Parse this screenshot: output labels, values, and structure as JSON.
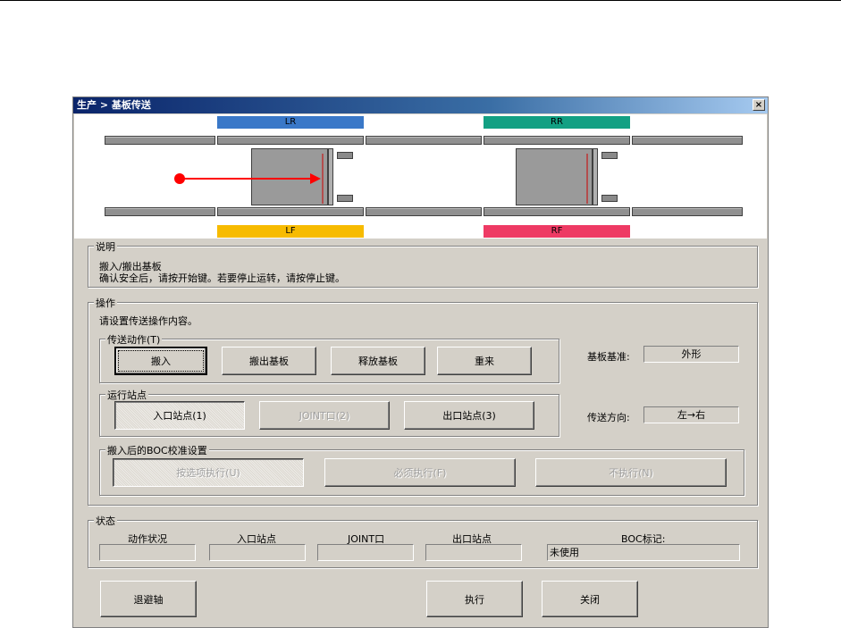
{
  "window": {
    "title": "生产 > 基板传送",
    "close_glyph": "×"
  },
  "diagram": {
    "labels": [
      {
        "text": "LR",
        "color": "#3a78c8"
      },
      {
        "text": "RR",
        "color": "#13a083"
      },
      {
        "text": "LF",
        "color": "#f7bb00"
      },
      {
        "text": "RF",
        "color": "#ee3a64"
      }
    ],
    "arrow_color": "#ff0000"
  },
  "description": {
    "legend": "说明",
    "line1": "搬入/搬出基板",
    "line2": "确认安全后，请按开始键。若要停止运转，请按停止键。"
  },
  "operation": {
    "legend": "操作",
    "prompt": "请设置传送操作内容。",
    "transfer": {
      "legend": "传送动作(T)",
      "buttons": [
        "搬入",
        "搬出基板",
        "释放基板",
        "重来"
      ]
    },
    "station": {
      "legend": "运行站点",
      "buttons": [
        "入口站点(1)",
        "JOINT口(2)",
        "出口站点(3)"
      ]
    },
    "boc": {
      "legend": "搬入后的BOC校准设置",
      "buttons": [
        "按选项执行(U)",
        "必须执行(F)",
        "不执行(N)"
      ]
    },
    "basis_label": "基板基准:",
    "basis_value": "外形",
    "direction_label": "传送方向:",
    "direction_value": "左→右"
  },
  "status": {
    "legend": "状态",
    "columns": [
      "动作状况",
      "入口站点",
      "JOINT口",
      "出口站点",
      "BOC标记:"
    ],
    "values": [
      "",
      "",
      "",
      "",
      "未使用"
    ]
  },
  "footer": {
    "retract": "退避轴",
    "execute": "执行",
    "close": "关闭"
  }
}
